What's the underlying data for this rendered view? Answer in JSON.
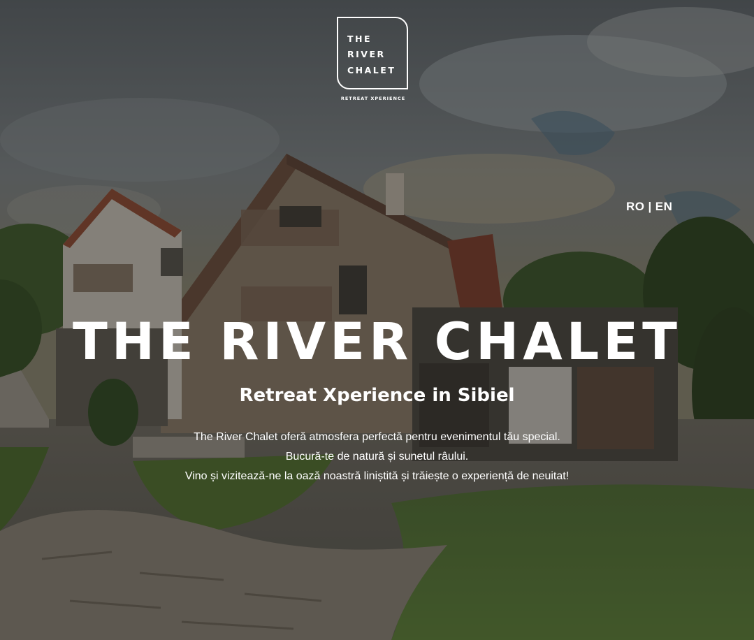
{
  "logo": {
    "line1": "THE",
    "line2": "RIVER",
    "line3": "CHALET",
    "tagline": "RETREAT XPERIENCE"
  },
  "language_switch": {
    "ro": "RO",
    "separator": "|",
    "en": "EN"
  },
  "hero": {
    "title": "THE RIVER CHALET",
    "subtitle": "Retreat Xperience in Sibiel",
    "description": [
      "The River Chalet oferă atmosfera perfectă pentru evenimentul tău special.",
      "Bucură-te de natură și sunetul râului.",
      "Vino și vizitează-ne la oază noastră liniștită și trăiește o experiență de neuitat!"
    ]
  },
  "colors": {
    "text": "#ffffff",
    "overlay": "#141412"
  }
}
